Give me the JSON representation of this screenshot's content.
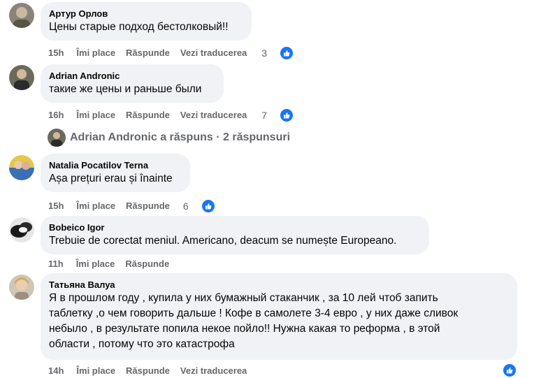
{
  "comments": [
    {
      "author": "Артур Орлов",
      "text": "Цены старые подход бестолковый!!",
      "time": "15h",
      "like_label": "Îmi place",
      "reply_label": "Răspunde",
      "translate_label": "Vezi traducerea",
      "likes": "3"
    },
    {
      "author": "Adrian Andronic",
      "text": "такие же цены и раньше были",
      "time": "16h",
      "like_label": "Îmi place",
      "reply_label": "Răspunde",
      "translate_label": "Vezi traducerea",
      "likes": "7"
    },
    {
      "author": "Natalia Pocatilov Terna",
      "text": "Așa prețuri erau și înainte",
      "time": "15h",
      "like_label": "Îmi place",
      "reply_label": "Răspunde",
      "likes": "6"
    },
    {
      "author": "Bobeico Igor",
      "text": "Trebuie de corectat meniul. Americano, deacum se numește Europeano.",
      "time": "11h",
      "like_label": "Îmi place",
      "reply_label": "Răspunde"
    },
    {
      "author": "Татьяна Валуа",
      "text_lines": [
        "Я в прошлом году , купила у них бумажный стаканчик , за 10 лей чтоб запить",
        "таблетку ,о чем говорить дальше ! Кофе в самолете 3-4 евро , у них даже сливок",
        "небыло , в результате попила некое пойло!! Нужна какая то реформа , в этой",
        "области , потому что это катастрофа"
      ],
      "time": "14h",
      "like_label": "Îmi place",
      "reply_label": "Răspunde",
      "translate_label": "Vezi traducerea"
    }
  ],
  "replies_row": {
    "text": "Adrian Andronic a răspuns · 2 răspunsuri"
  },
  "colors": {
    "bubble": "#f0f2f5",
    "muted": "#65676b",
    "like_blue": "#1877f2"
  },
  "icons": [
    "avatar",
    "like-thumb-icon"
  ]
}
